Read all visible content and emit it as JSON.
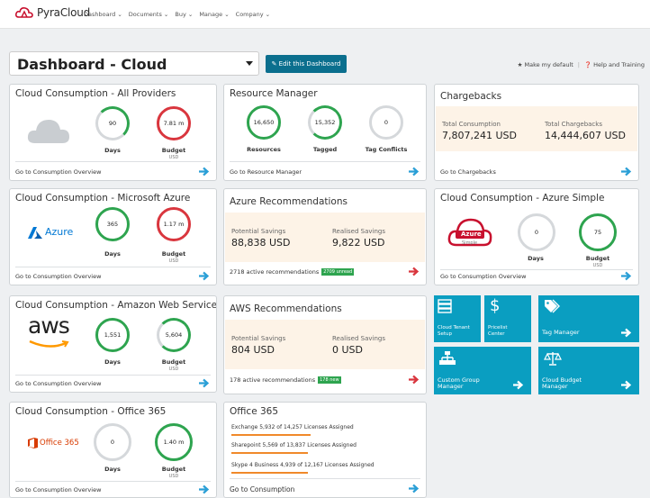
{
  "header": {
    "logo_text": "PyraCloud",
    "nav": [
      "Dashboard ⌄",
      "Documents ⌄",
      "Buy ⌄",
      "Manage ⌄",
      "Company ⌄"
    ]
  },
  "toolbar": {
    "dashboard_title": "Dashboard - Cloud",
    "edit_label": "✎ Edit this Dashboard",
    "make_default": "★ Make my default",
    "help": "❓ Help and Training"
  },
  "colors": {
    "accent": "#0b6f8e",
    "tile": "#0a9ec1",
    "good": "#2ea44f",
    "bad": "#d9363e",
    "orange": "#f0892a"
  },
  "cards": {
    "all_providers": {
      "title": "Cloud Consumption - All Providers",
      "days": "90",
      "days_label": "Days",
      "budget": "7.81 m",
      "budget_label": "Budget",
      "budget_unit": "USD",
      "footer": "Go to Consumption Overview"
    },
    "resource_manager": {
      "title": "Resource Manager",
      "resources": "16,650",
      "resources_label": "Resources",
      "tagged": "15,352",
      "tagged_label": "Tagged",
      "conflicts": "0",
      "conflicts_label": "Tag Conflicts",
      "footer": "Go to Resource Manager"
    },
    "chargebacks": {
      "title": "Chargebacks",
      "consumption_label": "Total Consumption",
      "consumption_value": "7,807,241 USD",
      "chargebacks_label": "Total Chargebacks",
      "chargebacks_value": "14,444,607 USD",
      "footer": "Go to Chargebacks"
    },
    "azure": {
      "title": "Cloud Consumption - Microsoft Azure",
      "logo": "Azure",
      "days": "365",
      "days_label": "Days",
      "budget": "1.17 m",
      "budget_label": "Budget",
      "budget_unit": "USD",
      "footer": "Go to Consumption Overview"
    },
    "azure_recs": {
      "title": "Azure Recommendations",
      "potential_label": "Potential Savings",
      "potential_value": "88,838 USD",
      "realised_label": "Realised Savings",
      "realised_value": "9,822 USD",
      "footer": "2718 active recommendations",
      "badge": "2709 unread"
    },
    "azure_simple": {
      "title": "Cloud Consumption - Azure Simple",
      "logo": "Azure",
      "logo_sub": "Simple",
      "days": "0",
      "days_label": "Days",
      "budget": "75",
      "budget_label": "Budget",
      "budget_unit": "USD",
      "footer": "Go to Consumption Overview"
    },
    "aws": {
      "title": "Cloud Consumption - Amazon Web Services",
      "logo": "aws",
      "days": "1,551",
      "days_label": "Days",
      "budget": "5,604",
      "budget_label": "Budget",
      "budget_unit": "USD",
      "footer": "Go to Consumption Overview"
    },
    "aws_recs": {
      "title": "AWS Recommendations",
      "potential_label": "Potential Savings",
      "potential_value": "804 USD",
      "realised_label": "Realised Savings",
      "realised_value": "0 USD",
      "footer": "178 active recommendations",
      "badge": "178 new"
    },
    "office365": {
      "title": "Cloud Consumption - Office 365",
      "logo": "Office 365",
      "days": "0",
      "days_label": "Days",
      "budget": "1.40 m",
      "budget_label": "Budget",
      "budget_unit": "USD",
      "footer": "Go to Consumption Overview"
    },
    "office_licenses": {
      "title": "Office 365",
      "lines": [
        "Exchange 5,932 of 14,257 Licenses Assigned",
        "Sharepoint 5,569 of 13,837 Licenses Assigned",
        "Skype 4 Business 4,939 of 12,167 Licenses Assigned"
      ],
      "footer": "Go to Consumption"
    }
  },
  "tiles": {
    "tenant": "Cloud Tenant Setup",
    "pricelist": "Pricelist Center",
    "tag_manager": "Tag Manager",
    "group_manager": "Custom Group Manager",
    "budget_manager": "Cloud Budget Manager"
  }
}
